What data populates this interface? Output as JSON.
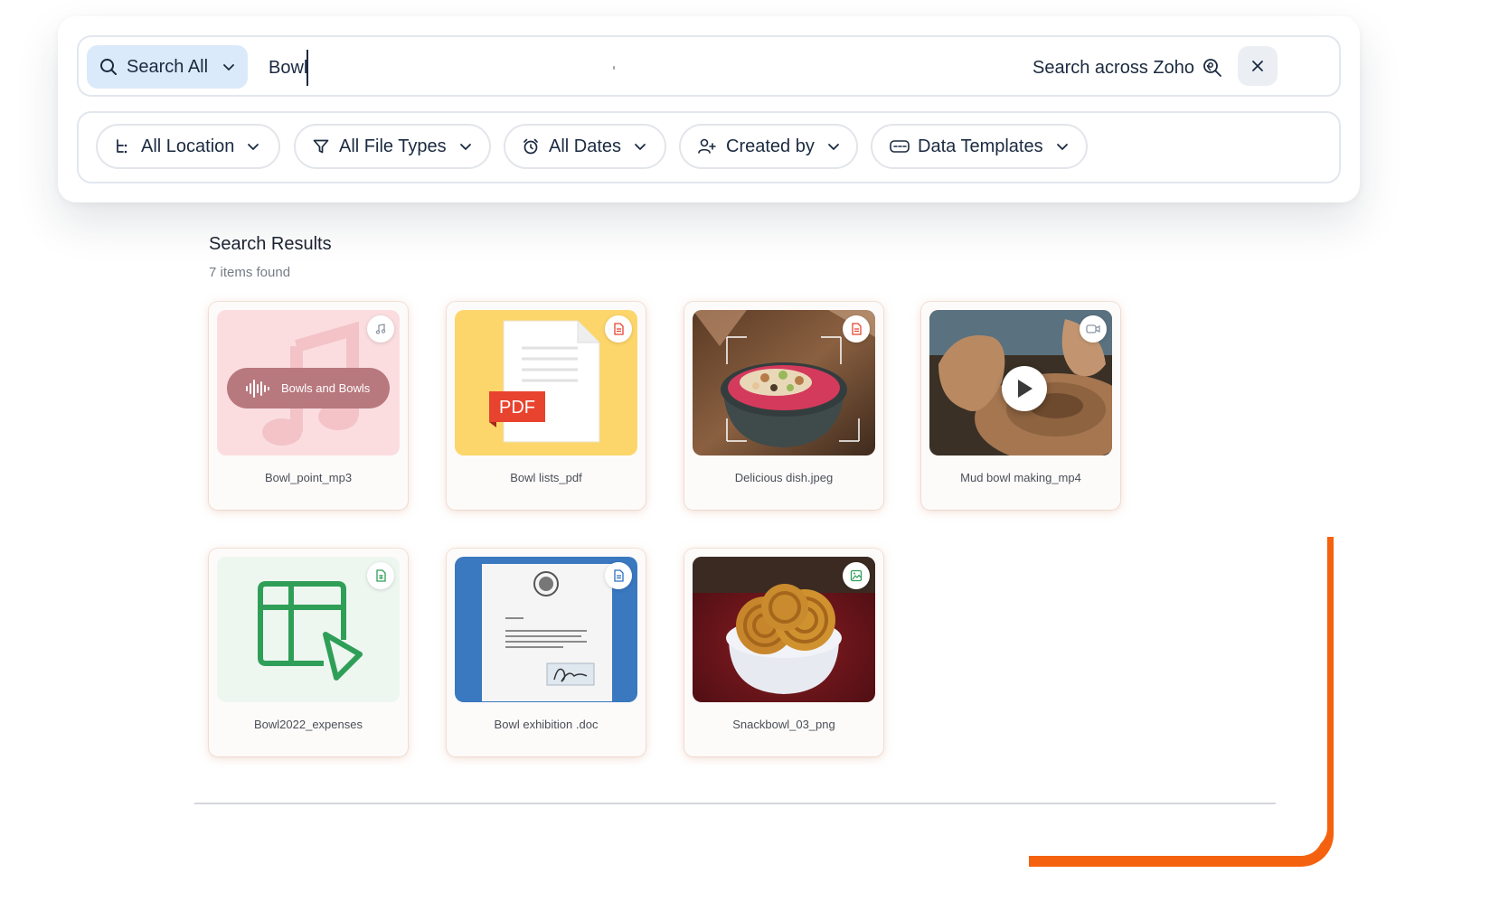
{
  "search": {
    "scope_label": "Search All",
    "query": "Bowl",
    "across_label": "Search across Zoho"
  },
  "filters": [
    {
      "label": "All Location",
      "icon": "location-tree-icon"
    },
    {
      "label": "All File Types",
      "icon": "filter-funnel-icon"
    },
    {
      "label": "All Dates",
      "icon": "alarm-clock-icon"
    },
    {
      "label": "Created by",
      "icon": "add-user-icon"
    },
    {
      "label": "Data Templates",
      "icon": "template-icon"
    }
  ],
  "results": {
    "title": "Search Results",
    "count_text": "7 items found",
    "items": [
      {
        "name": "Bowl_point_mp3",
        "type": "audio",
        "badge_icon": "music-note-icon",
        "audio_title": "Bowls and Bowls"
      },
      {
        "name": "Bowl lists_pdf",
        "type": "pdf",
        "badge_icon": "pdf-document-icon",
        "pdf_label": "PDF"
      },
      {
        "name": "Delicious dish.jpeg",
        "type": "image",
        "badge_icon": "document-icon"
      },
      {
        "name": "Mud bowl making_mp4",
        "type": "video",
        "badge_icon": "video-camera-icon"
      },
      {
        "name": "Bowl2022_expenses",
        "type": "spreadsheet",
        "badge_icon": "sheet-icon"
      },
      {
        "name": "Bowl exhibition .doc",
        "type": "document",
        "badge_icon": "writer-document-icon"
      },
      {
        "name": "Snackbowl_03_png",
        "type": "image",
        "badge_icon": "image-icon"
      }
    ]
  },
  "colors": {
    "accent_orange": "#f5620f",
    "scope_bg": "#dbeafb",
    "audio_thumb_bg": "#fbdde0",
    "pdf_thumb_bg": "#fdd66b",
    "sheet_thumb_bg": "#eef6f0",
    "doc_thumb_bg": "#3a78c0",
    "sheet_green": "#2f9f58",
    "pdf_red": "#e8432e"
  }
}
